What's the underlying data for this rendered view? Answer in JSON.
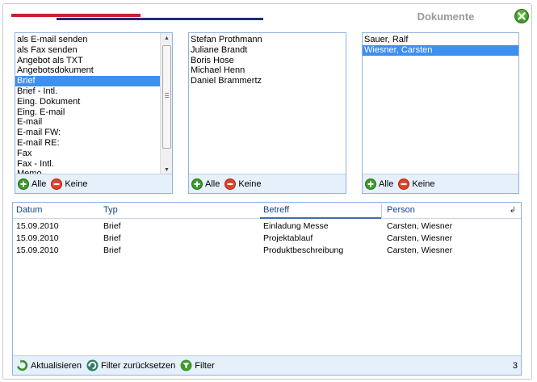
{
  "window": {
    "title": "Dokumente"
  },
  "lists": [
    {
      "items": [
        "als E-mail senden",
        "als Fax senden",
        "Angebot als TXT",
        "Angebotsdokument",
        "Brief",
        "Brief - Intl.",
        "Eing. Dokument",
        "Eing. E-mail",
        "E-mail",
        "E-mail FW:",
        "E-mail RE:",
        "Fax",
        "Fax - Intl.",
        "Memo"
      ],
      "selected_index": 4,
      "scroll_position": 0.0,
      "footer": {
        "all_label": "Alle",
        "none_label": "Keine"
      }
    },
    {
      "items": [
        "Stefan Prothmann",
        "Juliane Brandt",
        "Boris Hose",
        "Michael Henn",
        "Daniel Brammertz"
      ],
      "selected_index": -1,
      "footer": {
        "all_label": "Alle",
        "none_label": "Keine"
      }
    },
    {
      "items": [
        "Sauer, Ralf",
        "Wiesner, Carsten"
      ],
      "selected_index": 1,
      "footer": {
        "all_label": "Alle",
        "none_label": "Keine"
      }
    }
  ],
  "grid": {
    "columns": [
      "Datum",
      "Typ",
      "Betreff",
      "Person"
    ],
    "sorted_column": "Betreff",
    "rows": [
      [
        "15.09.2010",
        "Brief",
        "Einladung Messe",
        "Carsten, Wiesner"
      ],
      [
        "15.09.2010",
        "Brief",
        "Projektablauf",
        "Carsten, Wiesner"
      ],
      [
        "15.09.2010",
        "Brief",
        "Produktbeschreibung",
        "Carsten, Wiesner"
      ]
    ],
    "footer": {
      "refresh_label": "Aktualisieren",
      "reset_label": "Filter zurücksetzen",
      "filter_label": "Filter",
      "count": "3"
    }
  },
  "colors": {
    "accent_red": "#cc1f2e",
    "accent_blue": "#1c2f78",
    "selection": "#3d8ff0",
    "panel_border": "#8fb3dd",
    "footer_bg": "#e6f0fb"
  },
  "icons": {
    "close": "close-circle-icon",
    "all": "plus-circle-icon",
    "none": "minus-circle-icon",
    "refresh": "refresh-icon",
    "reset": "reset-filter-icon",
    "filter": "filter-icon"
  }
}
